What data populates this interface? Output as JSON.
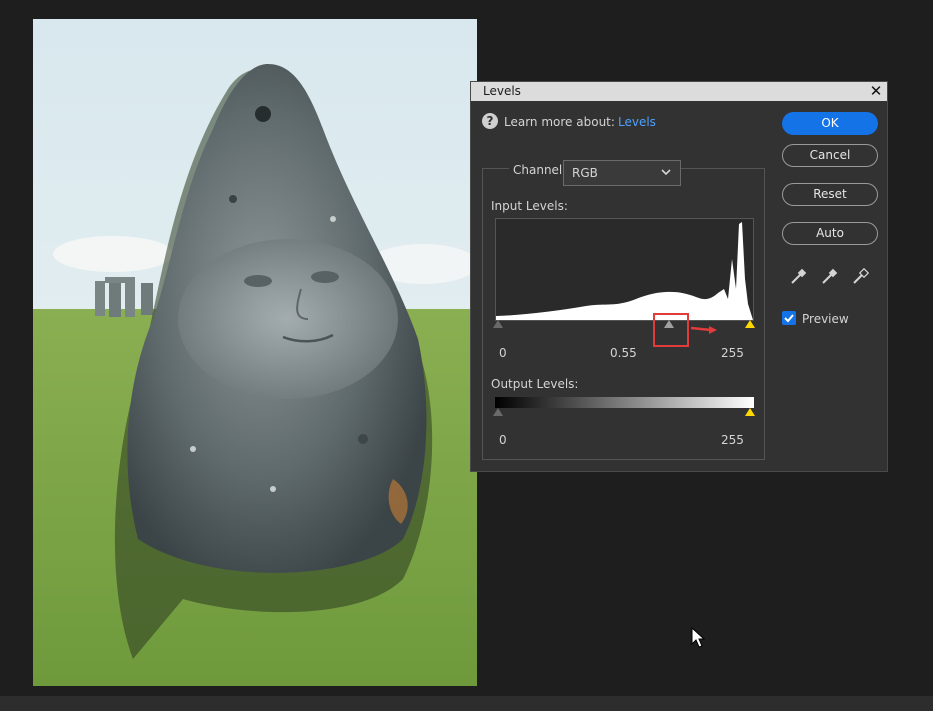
{
  "dialog": {
    "title": "Levels",
    "close_glyph": "✕",
    "learn_more_text": "Learn more about:",
    "learn_more_link": "Levels",
    "channel_label": "Channel:",
    "channel_value": "RGB",
    "input_levels_label": "Input Levels:",
    "input_black": "0",
    "input_gamma": "0.55",
    "input_white": "255",
    "output_levels_label": "Output Levels:",
    "output_black": "0",
    "output_white": "255"
  },
  "buttons": {
    "ok": "OK",
    "cancel": "Cancel",
    "reset": "Reset",
    "auto": "Auto"
  },
  "preview": {
    "label": "Preview",
    "checked": true
  },
  "colors": {
    "accent": "#1473e6",
    "link": "#4ea2ff",
    "highlight": "#e23b3b",
    "white_point": "#ffd900"
  },
  "icons": [
    "help-icon",
    "close-icon",
    "chevron-down-icon",
    "eyedropper-black-icon",
    "eyedropper-gray-icon",
    "eyedropper-white-icon",
    "checkmark-icon",
    "mouse-cursor-icon"
  ]
}
